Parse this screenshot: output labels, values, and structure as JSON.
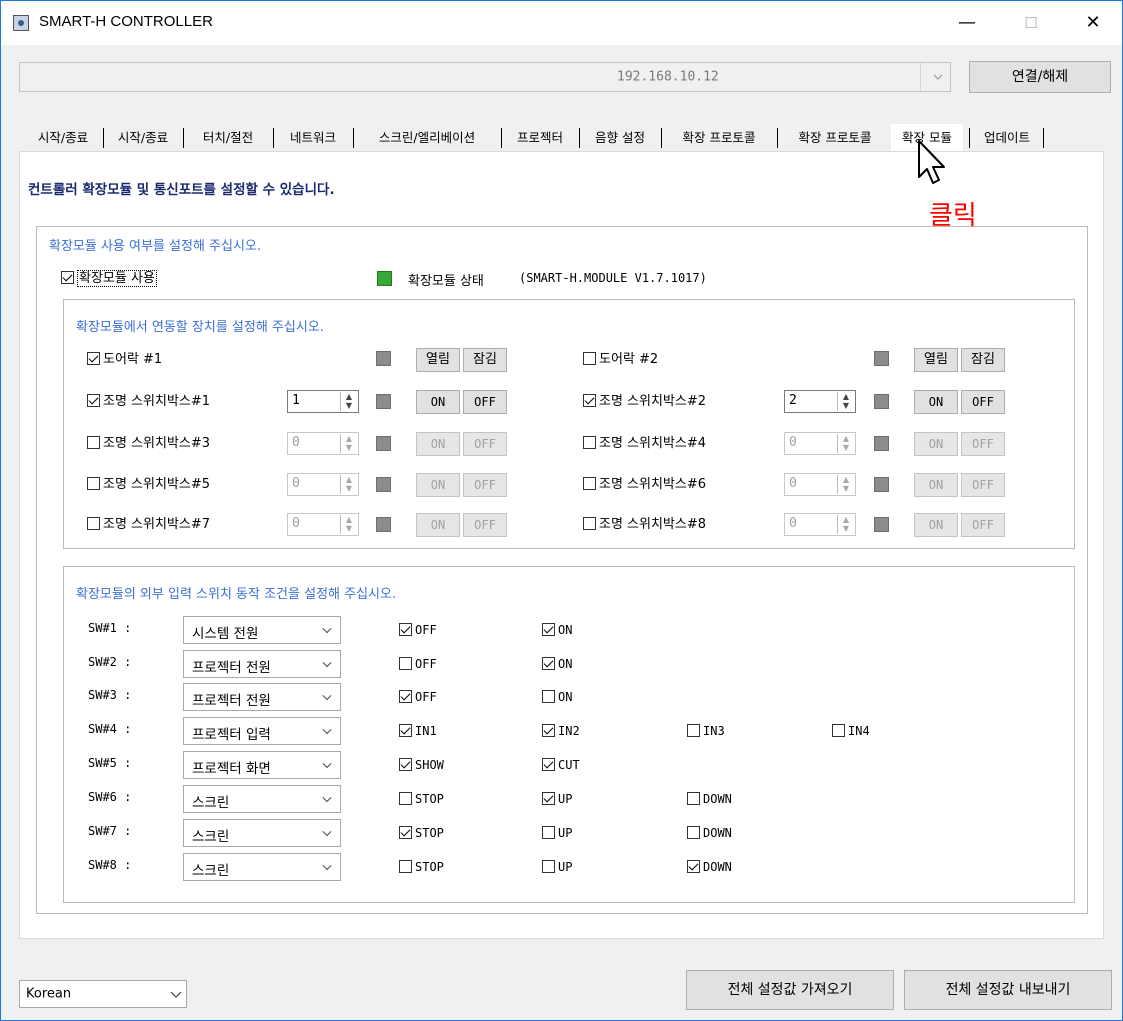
{
  "window": {
    "title": "SMART-H CONTROLLER",
    "minimize": "—",
    "maximize": "☐",
    "close": "✕"
  },
  "connection": {
    "ip": "192.168.10.12",
    "connect_label": "연결/해제"
  },
  "tabs": [
    "시작/종료",
    "시작/종료",
    "터치/절전",
    "네트워크",
    "스크린/엘리베이션",
    "프로젝터",
    "음향 설정",
    "확장 프로토콜",
    "확장 프로토콜",
    "확장 모듈",
    "업데이트"
  ],
  "active_tab": "확장 모듈",
  "annotation": {
    "text": "클릭",
    "color": "#ff0000"
  },
  "panel": {
    "heading": "컨트롤러 확장모듈 및 통신포트를 설정할 수 있습니다.",
    "module_group": {
      "title": "확장모듈 사용 여부를 설정해 주십시오.",
      "use_label": "확장모듈 사용",
      "use_checked": true,
      "status_label": "확장모듈 상태",
      "status_value": "(SMART-H.MODULE  V1.7.1017)",
      "status_color": "#37a937"
    },
    "devices_group": {
      "title": "확장모듈에서 연동할 장치를 설정해 주십시오.",
      "door1": {
        "label": "도어락 #1",
        "checked": true,
        "open": "열림",
        "lock": "잠김"
      },
      "door2": {
        "label": "도어락 #2",
        "checked": false,
        "open": "열림",
        "lock": "잠김"
      },
      "switches": [
        {
          "label": "조명 스위치박스#1",
          "checked": true,
          "value": "1",
          "on": "ON",
          "off": "OFF"
        },
        {
          "label": "조명 스위치박스#2",
          "checked": true,
          "value": "2",
          "on": "ON",
          "off": "OFF"
        },
        {
          "label": "조명 스위치박스#3",
          "checked": false,
          "value": "0",
          "on": "ON",
          "off": "OFF"
        },
        {
          "label": "조명 스위치박스#4",
          "checked": false,
          "value": "0",
          "on": "ON",
          "off": "OFF"
        },
        {
          "label": "조명 스위치박스#5",
          "checked": false,
          "value": "0",
          "on": "ON",
          "off": "OFF"
        },
        {
          "label": "조명 스위치박스#6",
          "checked": false,
          "value": "0",
          "on": "ON",
          "off": "OFF"
        },
        {
          "label": "조명 스위치박스#7",
          "checked": false,
          "value": "0",
          "on": "ON",
          "off": "OFF"
        },
        {
          "label": "조명 스위치박스#8",
          "checked": false,
          "value": "0",
          "on": "ON",
          "off": "OFF"
        }
      ]
    },
    "sw_group": {
      "title": "확장모듈의 외부 입력 스위치 동작 조건을 설정해 주십시오.",
      "rows": [
        {
          "label": "SW#1 :",
          "select": "시스템 전원",
          "options": [
            {
              "label": "OFF",
              "checked": true
            },
            {
              "label": "ON",
              "checked": true
            }
          ]
        },
        {
          "label": "SW#2 :",
          "select": "프로젝터 전원",
          "options": [
            {
              "label": "OFF",
              "checked": false
            },
            {
              "label": "ON",
              "checked": true
            }
          ]
        },
        {
          "label": "SW#3 :",
          "select": "프로젝터 전원",
          "options": [
            {
              "label": "OFF",
              "checked": true
            },
            {
              "label": "ON",
              "checked": false
            }
          ]
        },
        {
          "label": "SW#4 :",
          "select": "프로젝터 입력",
          "options": [
            {
              "label": "IN1",
              "checked": true
            },
            {
              "label": "IN2",
              "checked": true
            },
            {
              "label": "IN3",
              "checked": false
            },
            {
              "label": "IN4",
              "checked": false
            }
          ]
        },
        {
          "label": "SW#5 :",
          "select": "프로젝터 화면",
          "options": [
            {
              "label": "SHOW",
              "checked": true
            },
            {
              "label": "CUT",
              "checked": true
            }
          ]
        },
        {
          "label": "SW#6 :",
          "select": "스크린",
          "options": [
            {
              "label": "STOP",
              "checked": false
            },
            {
              "label": "UP",
              "checked": true
            },
            {
              "label": "DOWN",
              "checked": false
            }
          ]
        },
        {
          "label": "SW#7 :",
          "select": "스크린",
          "options": [
            {
              "label": "STOP",
              "checked": true
            },
            {
              "label": "UP",
              "checked": false
            },
            {
              "label": "DOWN",
              "checked": false
            }
          ]
        },
        {
          "label": "SW#8 :",
          "select": "스크린",
          "options": [
            {
              "label": "STOP",
              "checked": false
            },
            {
              "label": "UP",
              "checked": false
            },
            {
              "label": "DOWN",
              "checked": true
            }
          ]
        }
      ]
    }
  },
  "footer": {
    "language": "Korean",
    "import_label": "전체 설정값 가져오기",
    "export_label": "전체 설정값 내보내기"
  }
}
